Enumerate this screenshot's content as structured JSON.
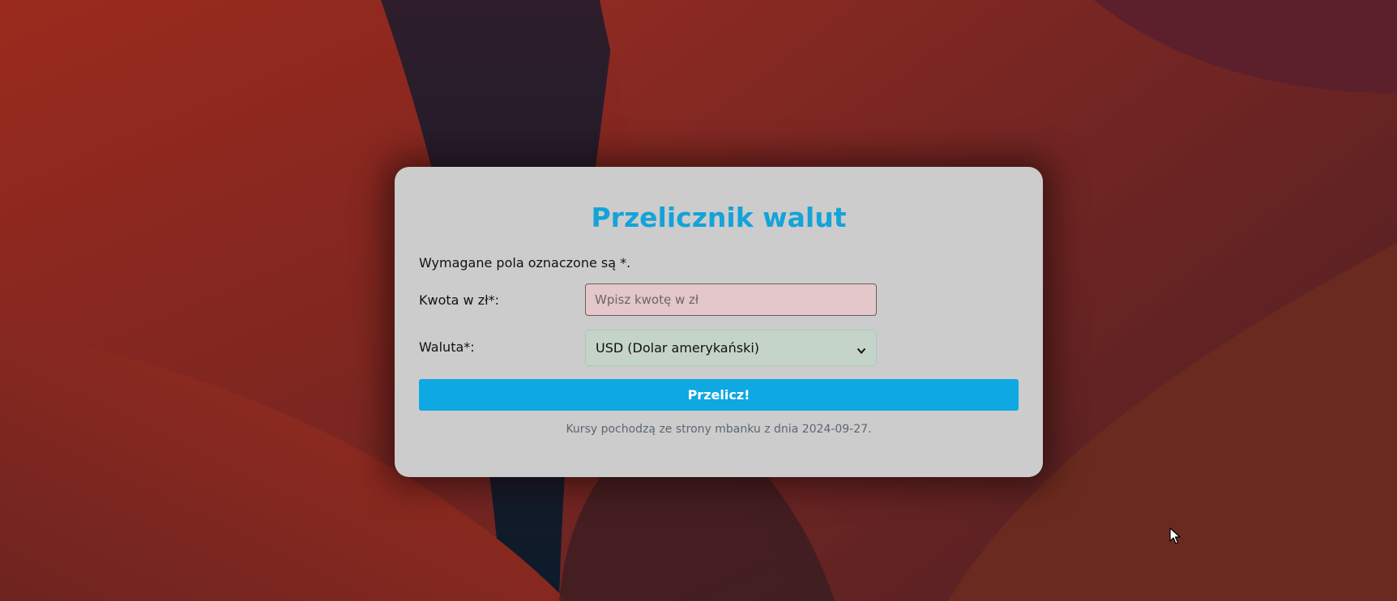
{
  "form": {
    "title": "Przelicznik walut",
    "required_note": "Wymagane pola oznaczone są *.",
    "amount_label": "Kwota w zł*:",
    "amount_placeholder": "Wpisz kwotę w zł",
    "amount_value": "",
    "currency_label": "Waluta*:",
    "currency_selected": "USD (Dolar amerykański)",
    "submit_label": "Przelicz!",
    "source_note": "Kursy pochodzą ze strony mbanku z dnia 2024-09-27."
  },
  "icons": {
    "select_arrow": "chevron-down-icon",
    "pointer": "mouse-cursor-icon"
  },
  "colors": {
    "accent": "#0ea8e2",
    "title": "#14a3d8",
    "card_background": "#cccccc",
    "amount_field_background": "#e3c7cb",
    "currency_field_background": "#c4d4c9"
  }
}
